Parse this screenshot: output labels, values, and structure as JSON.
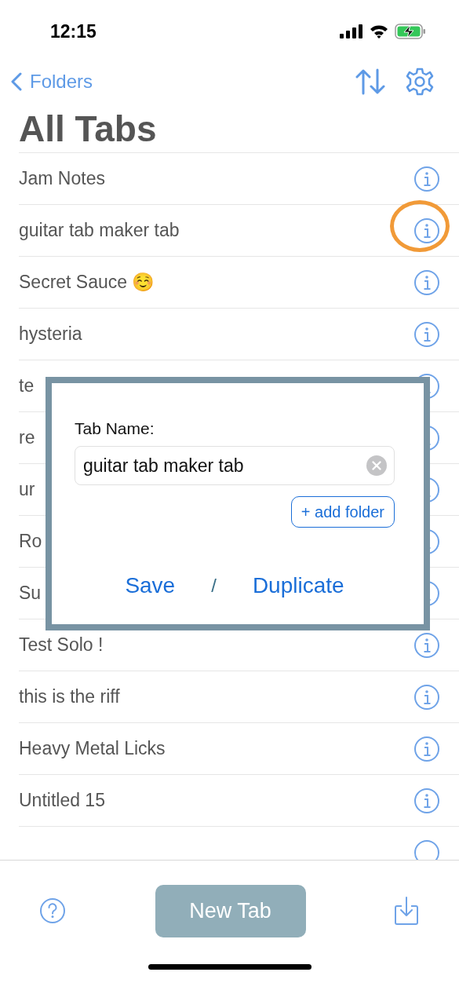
{
  "status_bar": {
    "time": "12:15",
    "charging": true
  },
  "nav": {
    "back_label": "Folders"
  },
  "title": "All Tabs",
  "tabs": [
    {
      "label": "Jam Notes",
      "highlighted": false
    },
    {
      "label": "guitar tab maker tab",
      "highlighted": true
    },
    {
      "label": "Secret Sauce ☺️",
      "highlighted": false
    },
    {
      "label": "hysteria",
      "highlighted": false
    },
    {
      "label": "te",
      "highlighted": false
    },
    {
      "label": "re",
      "highlighted": false
    },
    {
      "label": "ur",
      "highlighted": false
    },
    {
      "label": "Ro",
      "highlighted": false
    },
    {
      "label": "Su",
      "highlighted": false
    },
    {
      "label": "Test Solo !",
      "highlighted": false
    },
    {
      "label": "this is the riff",
      "highlighted": false
    },
    {
      "label": "Heavy Metal Licks",
      "highlighted": false
    },
    {
      "label": "Untitled 15",
      "highlighted": false
    }
  ],
  "dialog": {
    "label": "Tab Name:",
    "value": "guitar tab maker tab",
    "add_folder": "+ add folder",
    "save": "Save",
    "separator": "/",
    "duplicate": "Duplicate"
  },
  "bottom_bar": {
    "new_tab": "New Tab"
  }
}
